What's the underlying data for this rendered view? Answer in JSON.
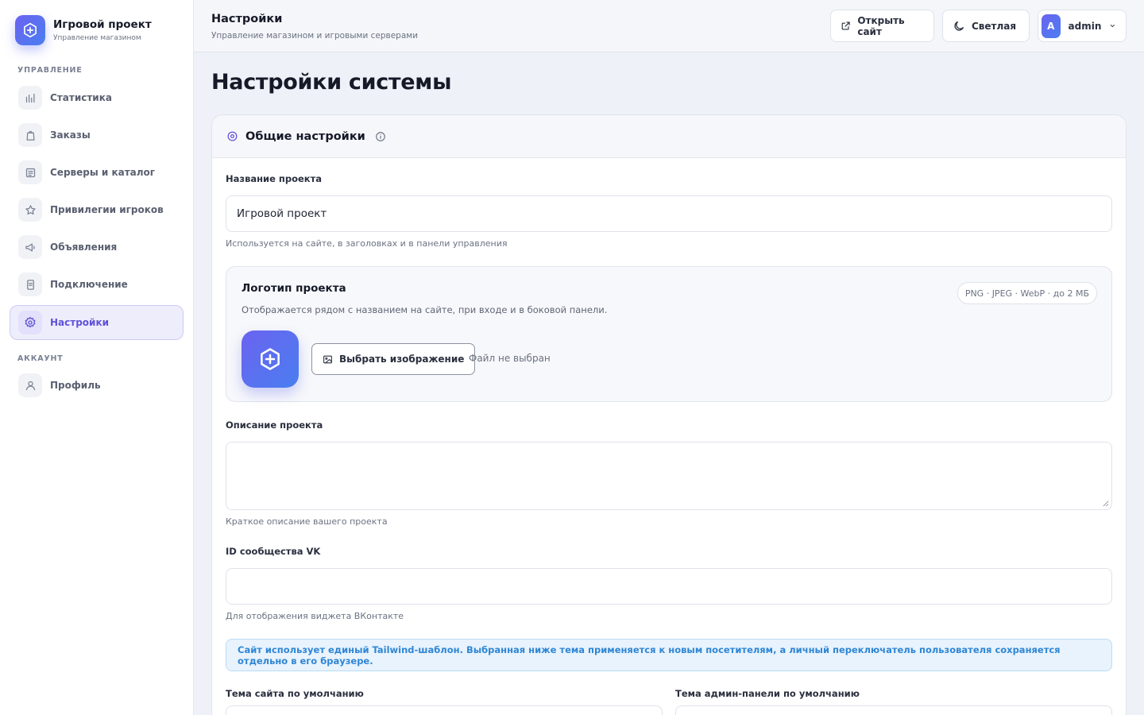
{
  "brand": {
    "title": "Игровой проект",
    "subtitle": "Управление магазином"
  },
  "sidebar": {
    "section_manage": "УПРАВЛЕНИЕ",
    "section_account": "АККАУНТ",
    "items": [
      {
        "label": "Статистика",
        "icon": "bar-chart-icon"
      },
      {
        "label": "Заказы",
        "icon": "shopping-bag-icon"
      },
      {
        "label": "Серверы и каталог",
        "icon": "list-icon"
      },
      {
        "label": "Привилегии игроков",
        "icon": "star-icon"
      },
      {
        "label": "Объявления",
        "icon": "megaphone-icon"
      },
      {
        "label": "Подключение",
        "icon": "document-icon"
      },
      {
        "label": "Настройки",
        "icon": "gear-icon",
        "active": true
      }
    ],
    "account_items": [
      {
        "label": "Профиль",
        "icon": "user-icon"
      }
    ]
  },
  "topbar": {
    "title": "Настройки",
    "subtitle": "Управление магазином и игровыми серверами",
    "open_site": "Открыть сайт",
    "theme": "Светлая",
    "user_initial": "A",
    "username": "admin"
  },
  "main": {
    "page_title": "Настройки системы",
    "card_title": "Общие настройки",
    "project_name": {
      "label": "Название проекта",
      "value": "Игровой проект",
      "help": "Используется на сайте, в заголовках и в панели управления"
    },
    "logo": {
      "title": "Логотип проекта",
      "description": "Отображается рядом с названием на сайте, при входе и в боковой панели.",
      "formats": "PNG · JPEG · WebP · до 2 МБ",
      "pick_button": "Выбрать изображение",
      "no_file": "Файл не выбран"
    },
    "description": {
      "label": "Описание проекта",
      "value": "",
      "help": "Краткое описание вашего проекта"
    },
    "vk": {
      "label": "ID сообщества VK",
      "value": "",
      "help": "Для отображения виджета ВКонтакте"
    },
    "alert": "Сайт использует единый Tailwind-шаблон. Выбранная ниже тема применяется к новым посетителям, а личный переключатель пользователя сохраняется отдельно в его браузере.",
    "site_theme_label": "Тема сайта по умолчанию",
    "admin_theme_label": "Тема админ-панели по умолчанию"
  },
  "colors": {
    "accent": "#6052d9",
    "brand_gradient_start": "#6b63f0",
    "brand_gradient_end": "#4a7ef0",
    "alert_text": "#2f86d4"
  }
}
